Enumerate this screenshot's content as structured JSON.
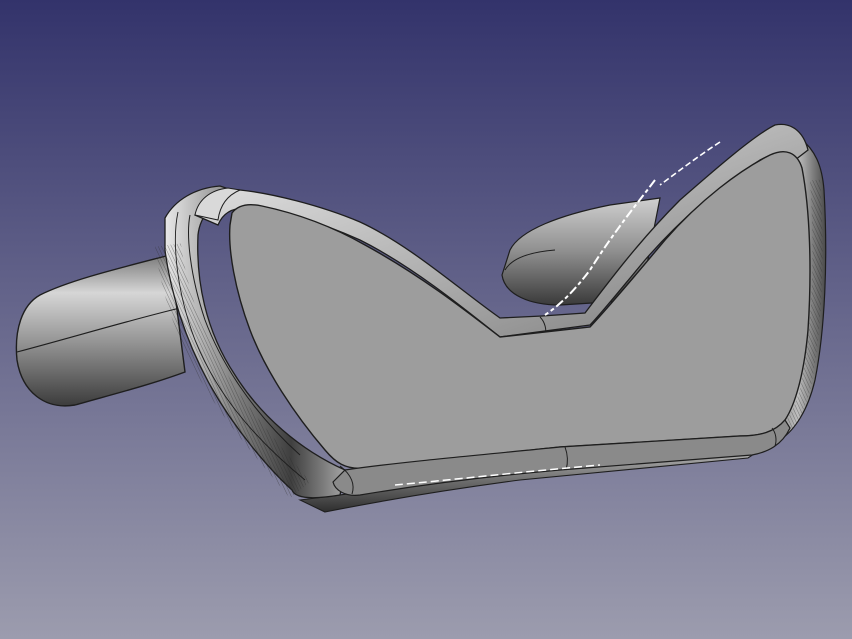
{
  "viewport": {
    "background": {
      "top_color": "#33336b",
      "bottom_color": "#9c9cae"
    },
    "model": {
      "face_color": "#9d9d9d",
      "edge_color": "#1e1e1e",
      "highlight_color": "#ffffff",
      "shadow_color": "#333333"
    }
  }
}
